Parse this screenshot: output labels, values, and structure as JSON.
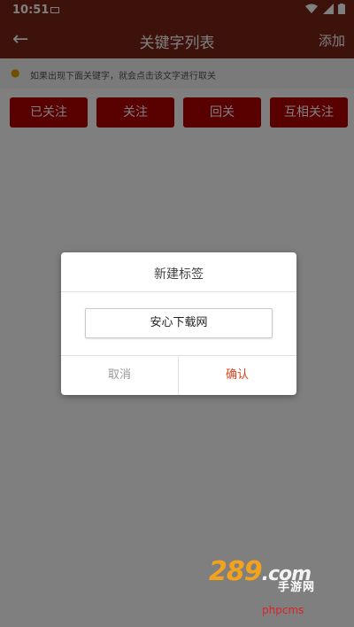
{
  "status_bar": {
    "time": "10:51",
    "icons": [
      "wifi-icon",
      "signal-icon",
      "battery-icon"
    ]
  },
  "app_bar": {
    "title": "关键字列表",
    "action": "添加"
  },
  "hint": {
    "text": "如果出现下面关键字，就会点击该文字进行取关"
  },
  "tags": [
    "已关注",
    "关注",
    "回关",
    "互相关注"
  ],
  "dialog": {
    "title": "新建标签",
    "input_value": "安心下载网",
    "cancel": "取消",
    "confirm": "确认"
  },
  "watermark": {
    "logo": "289",
    "domain": ".com",
    "sub": "手游网",
    "cms": "phpcms"
  },
  "colors": {
    "app_bar": "#7a2417",
    "tag": "#b30000",
    "confirm": "#d9431a",
    "overlay": "rgba(0,0,0,0.5)"
  }
}
